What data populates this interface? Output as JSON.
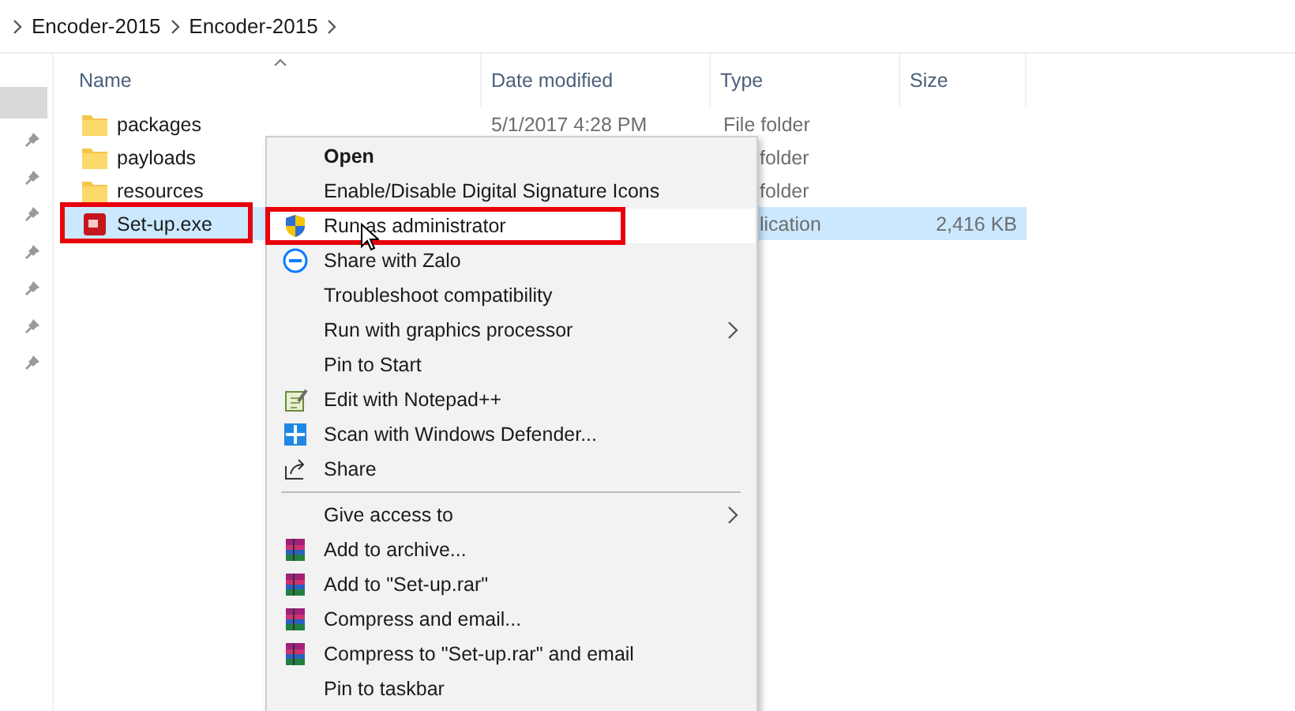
{
  "breadcrumb": [
    "Encoder-2015",
    "Encoder-2015"
  ],
  "columns": [
    {
      "label": "Name",
      "sorted": true
    },
    {
      "label": "Date modified",
      "sorted": false
    },
    {
      "label": "Type",
      "sorted": false
    },
    {
      "label": "Size",
      "sorted": false
    }
  ],
  "files": [
    {
      "name": "packages",
      "kind": "folder",
      "date": "5/1/2017 4:28 PM",
      "type": "File folder",
      "selected": false,
      "annotated": false
    },
    {
      "name": "payloads",
      "kind": "folder",
      "type": "folder",
      "selected": false,
      "annotated": false
    },
    {
      "name": "resources",
      "kind": "folder",
      "type": "folder",
      "selected": false,
      "annotated": false
    },
    {
      "name": "Set-up.exe",
      "kind": "app",
      "type": "lication",
      "size": "2,416 KB",
      "selected": true,
      "annotated": true
    }
  ],
  "context_menu": {
    "items": [
      {
        "kind": "plain",
        "label": "Open",
        "default": true,
        "hovered": false,
        "annotated": false,
        "submenu": false
      },
      {
        "kind": "plain",
        "label": "Enable/Disable Digital Signature Icons",
        "default": false,
        "hovered": false,
        "annotated": false,
        "submenu": false
      },
      {
        "kind": "shield",
        "label": "Run as administrator",
        "default": false,
        "hovered": true,
        "annotated": true,
        "submenu": false
      },
      {
        "kind": "zalo",
        "label": "Share with Zalo",
        "default": false,
        "hovered": false,
        "annotated": false,
        "submenu": false
      },
      {
        "kind": "plain",
        "label": "Troubleshoot compatibility",
        "default": false,
        "hovered": false,
        "annotated": false,
        "submenu": false
      },
      {
        "kind": "plain",
        "label": "Run with graphics processor",
        "default": false,
        "hovered": false,
        "annotated": false,
        "submenu": true
      },
      {
        "kind": "plain",
        "label": "Pin to Start",
        "default": false,
        "hovered": false,
        "annotated": false,
        "submenu": false
      },
      {
        "kind": "notepad",
        "label": "Edit with Notepad++",
        "default": false,
        "hovered": false,
        "annotated": false,
        "submenu": false
      },
      {
        "kind": "defender",
        "label": "Scan with Windows Defender...",
        "default": false,
        "hovered": false,
        "annotated": false,
        "submenu": false
      },
      {
        "kind": "share",
        "label": "Share",
        "default": false,
        "hovered": false,
        "annotated": false,
        "submenu": false
      },
      {
        "kind": "separator"
      },
      {
        "kind": "plain",
        "label": "Give access to",
        "default": false,
        "hovered": false,
        "annotated": false,
        "submenu": true
      },
      {
        "kind": "archive",
        "label": "Add to archive...",
        "default": false,
        "hovered": false,
        "annotated": false,
        "submenu": false
      },
      {
        "kind": "archive",
        "label": "Add to \"Set-up.rar\"",
        "default": false,
        "hovered": false,
        "annotated": false,
        "submenu": false
      },
      {
        "kind": "archive",
        "label": "Compress and email...",
        "default": false,
        "hovered": false,
        "annotated": false,
        "submenu": false
      },
      {
        "kind": "archive",
        "label": "Compress to \"Set-up.rar\" and email",
        "default": false,
        "hovered": false,
        "annotated": false,
        "submenu": false
      },
      {
        "kind": "plain",
        "label": "Pin to taskbar",
        "default": false,
        "hovered": false,
        "annotated": false,
        "submenu": false
      }
    ]
  }
}
